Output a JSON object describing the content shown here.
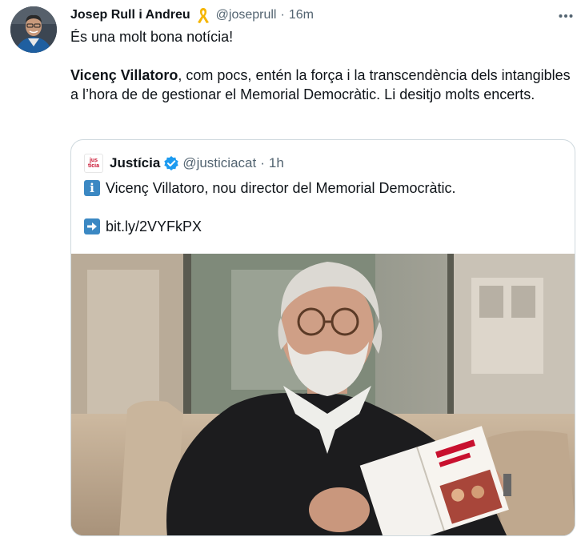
{
  "tweet": {
    "author_name": "Josep Rull i Andreu",
    "author_handle": "@joseprull",
    "separator": "·",
    "time": "16m",
    "more_icon": "more-horizontal-icon",
    "ribbon_icon": "yellow-ribbon-icon",
    "text_line1": "És una molt bona notícia!",
    "text_bold": "Vicenç Villatoro",
    "text_rest": ", com pocs, entén la força i la transcendència dels intangibles a l’hora de de gestionar el Memorial Democràtic. Li desitjo molts encerts."
  },
  "quote": {
    "logo_text_top": "jus",
    "logo_text_bottom": "tícia",
    "author_name": "Justícia",
    "author_handle": "@justiciacat",
    "separator": "·",
    "time": "1h",
    "verified_icon": "verified-badge-icon",
    "info_icon": "information-emoji-icon",
    "info_icon_glyph": "i",
    "line1": "Vicenç Villatoro, nou director del Memorial Democràtic.",
    "arrow_icon": "right-arrow-emoji-icon",
    "link": "bit.ly/2VYFkPX"
  },
  "colors": {
    "text": "#0f1419",
    "secondary": "#536471",
    "verified": "#1d9bf0",
    "border": "#cfd9de",
    "emoji_blue": "#3b88c3",
    "ribbon": "#f5b500"
  }
}
